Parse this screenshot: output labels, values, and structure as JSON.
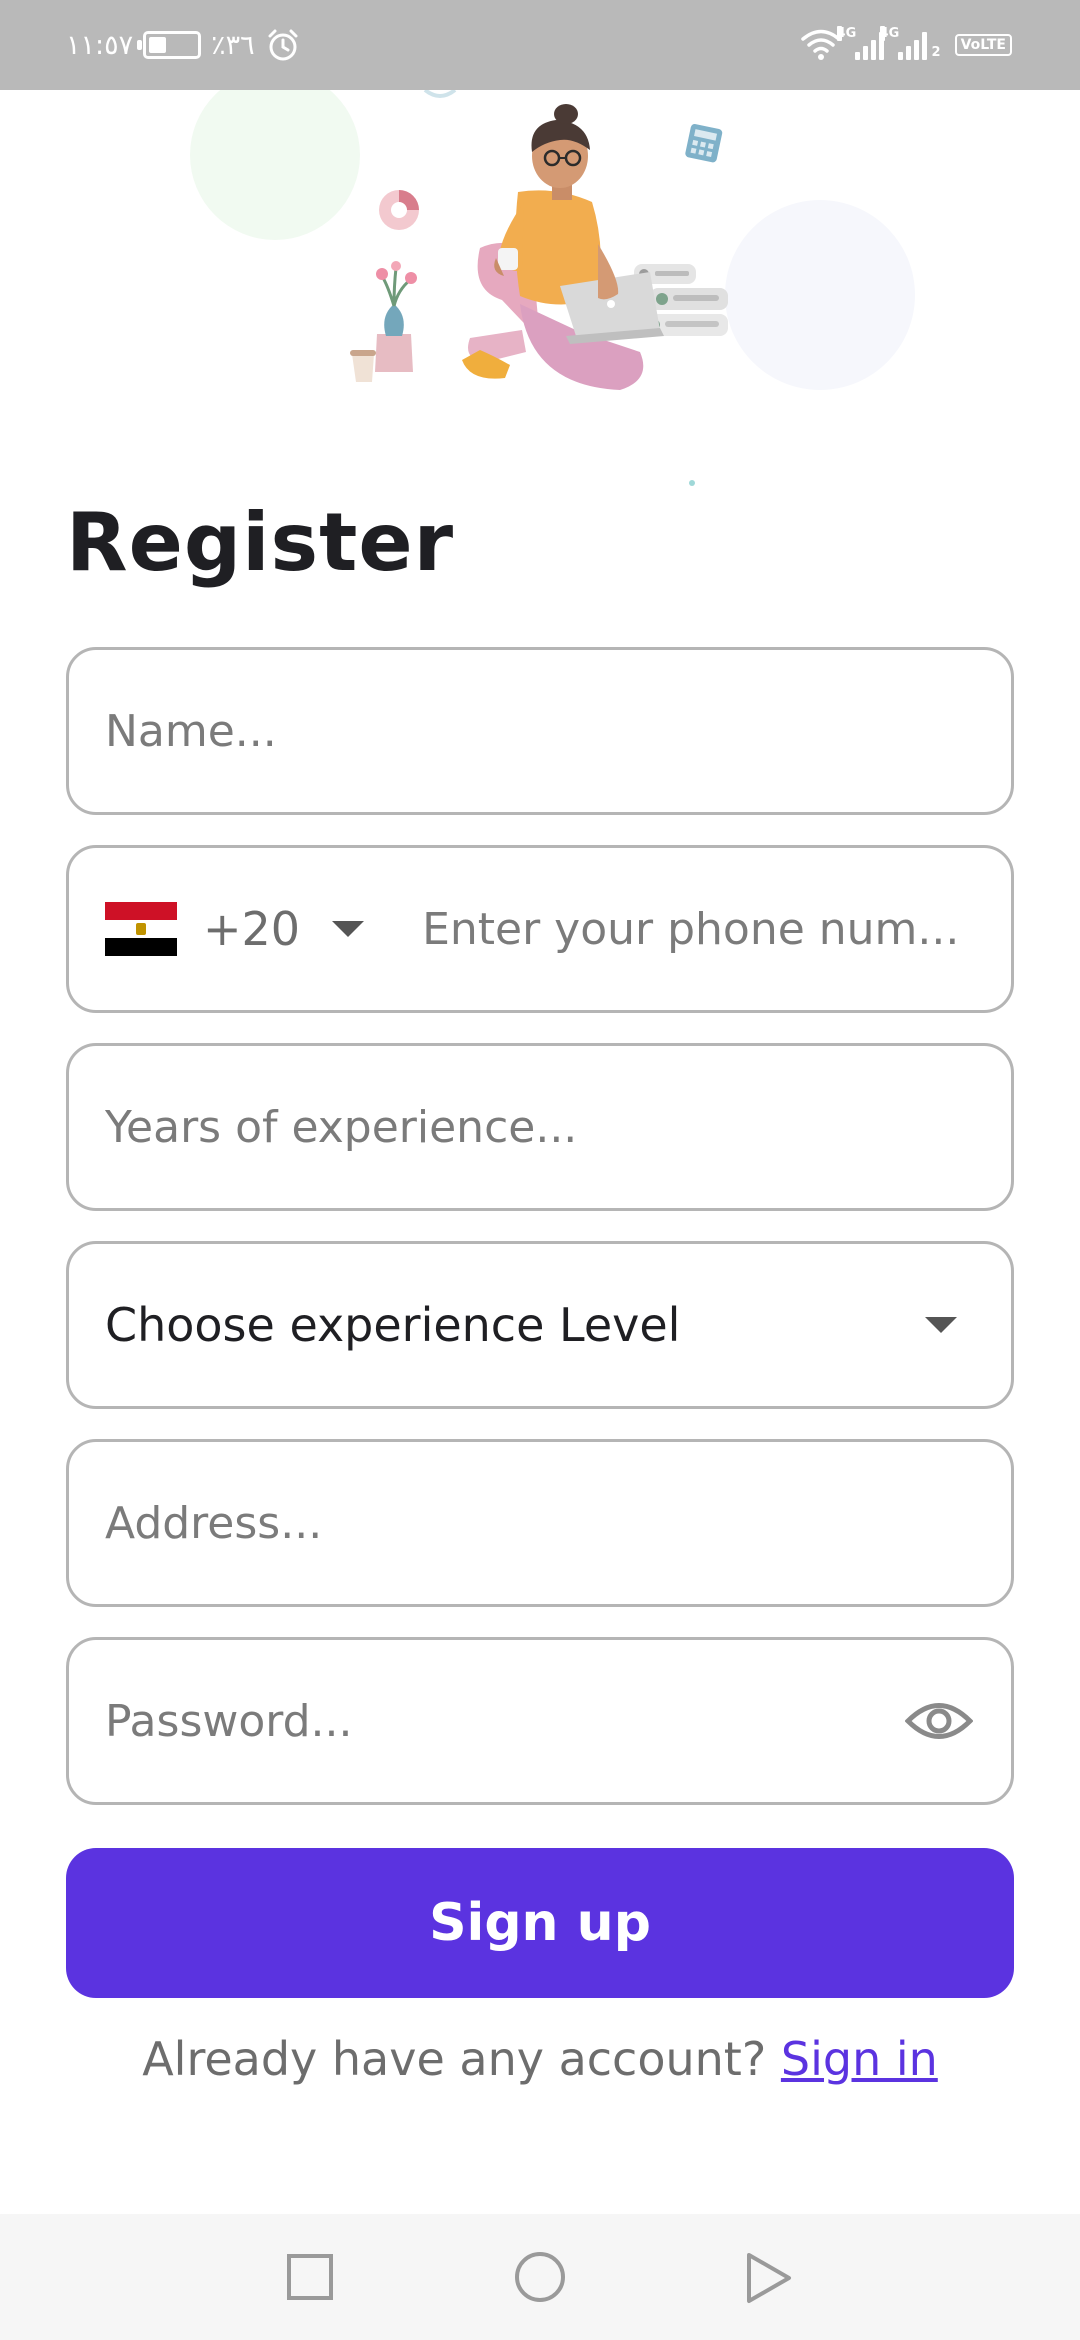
{
  "status_bar": {
    "time": "١١:٥٧",
    "battery_percent": "٪٣٦",
    "battery_level": 0.36,
    "network_1": "4G",
    "network_2": "4G",
    "sim_badge": "2",
    "volte": "VoLTE"
  },
  "screen": {
    "title": "Register"
  },
  "form": {
    "name_placeholder": "Name...",
    "phone_dial_code": "+20",
    "phone_placeholder": "Enter your phone num...",
    "years_placeholder": "Years of experience...",
    "experience_level_value": "Choose experience Level",
    "address_placeholder": "Address...",
    "password_placeholder": "Password...",
    "signup_label": "Sign up"
  },
  "footer": {
    "prompt": "Already have any account?",
    "signin_label": "Sign in"
  },
  "colors": {
    "accent": "#5b33e0",
    "status_bar": "#b9b9b9",
    "field_border": "#b5b5b5"
  },
  "icons": {
    "flag": "egypt-flag-icon",
    "dropdown": "chevron-down-icon",
    "password_toggle": "eye-icon",
    "nav_recents": "square-icon",
    "nav_home": "circle-icon",
    "nav_back": "triangle-icon"
  }
}
